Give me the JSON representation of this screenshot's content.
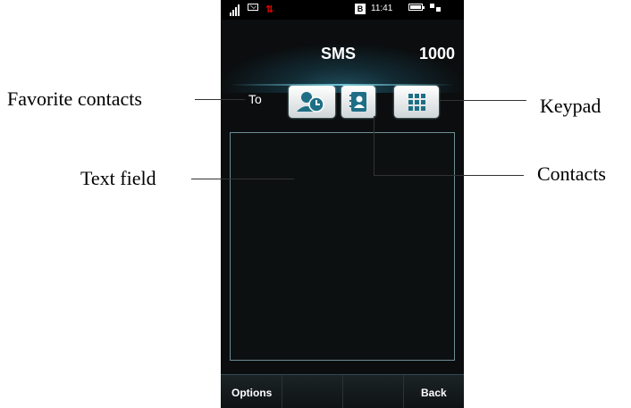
{
  "phone": {
    "status_bar": {
      "time": "11:41",
      "badge": "B"
    },
    "header": {
      "title": "SMS",
      "char_count": "1000"
    },
    "to_label": "To",
    "text_field": {
      "value": ""
    },
    "softkeys": {
      "left": "Options",
      "right": "Back"
    }
  },
  "callouts": {
    "favorite_contacts": "Favorite contacts",
    "text_field": "Text field",
    "keypad": "Keypad",
    "contacts": "Contacts"
  },
  "colors": {
    "accent": "#1e6f85",
    "screen_bg": "#0b0d0e",
    "alert": "#e00000"
  },
  "icons": [
    "signal-icon",
    "message-icon",
    "data-transfer-icon",
    "battery-icon",
    "network-icon",
    "favorite-contacts-icon",
    "contacts-icon",
    "keypad-icon"
  ]
}
